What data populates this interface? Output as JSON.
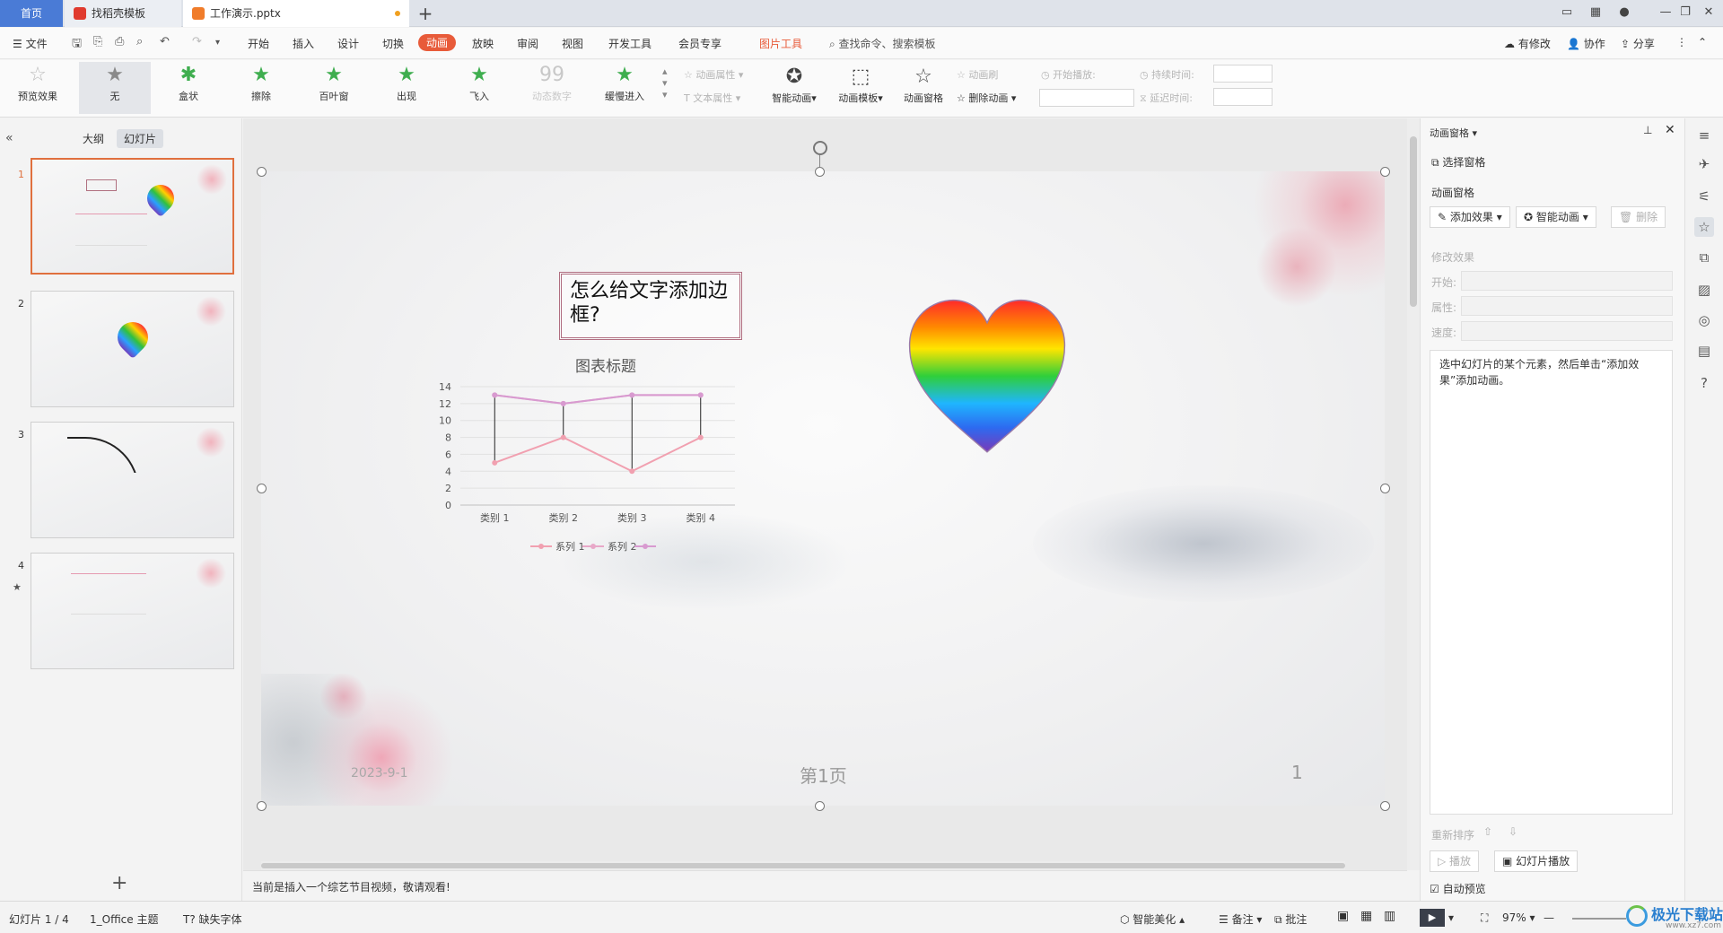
{
  "tabs": {
    "home": "首页",
    "template": "找稻壳模板",
    "document": "工作演示.pptx"
  },
  "menu": {
    "file": "文件",
    "items": [
      "开始",
      "插入",
      "设计",
      "切换",
      "动画",
      "放映",
      "审阅",
      "视图",
      "开发工具",
      "会员专享"
    ],
    "active": "动画",
    "picture_tools": "图片工具",
    "search": "查找命令、搜索模板",
    "modified": "有修改",
    "collab": "协作",
    "share": "分享"
  },
  "ribbon": {
    "preview": "预览效果",
    "effects": [
      "无",
      "盒状",
      "擦除",
      "百叶窗",
      "出现",
      "飞入",
      "动态数字",
      "缓慢进入"
    ],
    "anim_props": "动画属性",
    "text_props": "文本属性",
    "smart_anim": "智能动画",
    "anim_template": "动画模板",
    "anim_pane": "动画窗格",
    "anim_brush": "动画刷",
    "delete_anim": "删除动画",
    "start_play": "开始播放:",
    "duration": "持续时间:",
    "delay": "延迟时间:"
  },
  "left_panel": {
    "outline": "大纲",
    "slides": "幻灯片",
    "numbers": [
      "1",
      "2",
      "3",
      "4"
    ]
  },
  "slide": {
    "textbox": "怎么给文字添加边框?",
    "date": "2023-9-1",
    "footer": "第1页",
    "page_num": "1"
  },
  "chart_data": {
    "type": "line",
    "title": "图表标题",
    "categories": [
      "类别 1",
      "类别 2",
      "类别 3",
      "类别 4"
    ],
    "series": [
      {
        "name": "系列 1",
        "values": [
          5,
          8,
          4,
          8
        ],
        "color": "#f1a0b0"
      },
      {
        "name": "系列 2",
        "values": [
          13,
          12,
          13,
          13
        ],
        "color": "#e8a8c8"
      },
      {
        "name": "",
        "values": [
          13,
          12,
          13,
          13
        ],
        "color": "#d89ad0"
      }
    ],
    "ylim": [
      0,
      14
    ],
    "yticks": [
      "0",
      "2",
      "4",
      "6",
      "8",
      "10",
      "12",
      "14"
    ],
    "grid": true,
    "legend": "bottom",
    "high_low_lines": true
  },
  "status": {
    "notes": "当前是插入一个综艺节目视频，敬请观看!",
    "slide_count": "幻灯片 1 / 4",
    "theme": "1_Office 主题",
    "missing_font": "缺失字体",
    "beautify": "智能美化",
    "remarks": "备注",
    "comments": "批注",
    "zoom": "97%"
  },
  "right_panel": {
    "title": "动画窗格",
    "select_pane": "选择窗格",
    "section": "动画窗格",
    "add_effect": "添加效果",
    "smart_anim": "智能动画",
    "delete": "删除",
    "modify": "修改效果",
    "start": "开始:",
    "property": "属性:",
    "speed": "速度:",
    "hint": "选中幻灯片的某个元素，然后单击“添加效果”添加动画。",
    "reorder": "重新排序",
    "play": "播放",
    "slideshow": "幻灯片播放",
    "autopreview": "自动预览"
  },
  "watermark": {
    "text": "极光下载站",
    "url": "www.xz7.com"
  }
}
